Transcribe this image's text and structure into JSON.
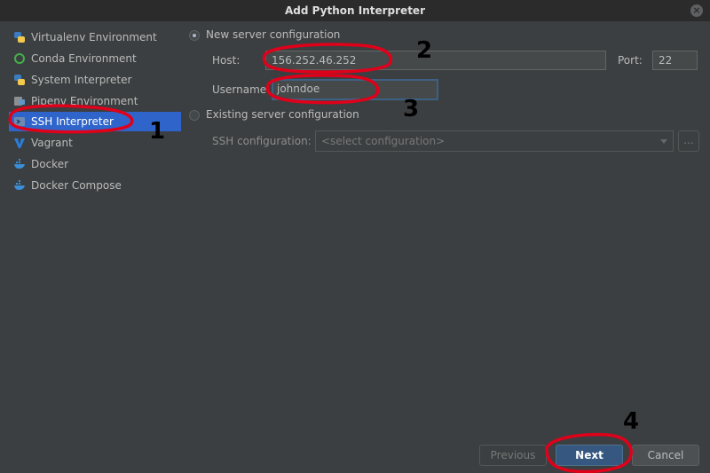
{
  "window": {
    "title": "Add Python Interpreter",
    "close_glyph": "×"
  },
  "sidebar": {
    "items": [
      {
        "label": "Virtualenv Environment",
        "icon": "python-icon"
      },
      {
        "label": "Conda Environment",
        "icon": "conda-icon"
      },
      {
        "label": "System Interpreter",
        "icon": "python-icon"
      },
      {
        "label": "Pipenv Environment",
        "icon": "pipenv-icon"
      },
      {
        "label": "SSH Interpreter",
        "icon": "ssh-terminal-icon",
        "selected": true
      },
      {
        "label": "Vagrant",
        "icon": "vagrant-icon"
      },
      {
        "label": "Docker",
        "icon": "docker-icon"
      },
      {
        "label": "Docker Compose",
        "icon": "docker-icon"
      }
    ]
  },
  "form": {
    "new_server_label": "New server configuration",
    "host_label": "Host:",
    "host_value": "156.252.46.252",
    "port_label": "Port:",
    "port_value": "22",
    "username_label": "Username:",
    "username_value": "johndoe",
    "existing_server_label": "Existing server configuration",
    "ssh_config_label": "SSH configuration:",
    "ssh_config_placeholder": "<select configuration>",
    "browse_glyph": "..."
  },
  "buttons": {
    "previous": "Previous",
    "next": "Next",
    "cancel": "Cancel"
  },
  "annotations": {
    "a1": "1",
    "a2": "2",
    "a3": "3",
    "a4": "4"
  },
  "colors": {
    "background": "#3c3f41",
    "titlebar": "#2b2b2b",
    "selection": "#2f65ca",
    "primary_button": "#365880",
    "annotation_red": "#e0001a"
  }
}
